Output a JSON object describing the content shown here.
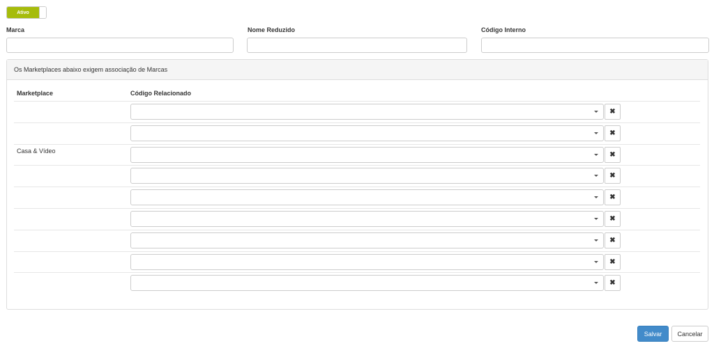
{
  "status_toggle": {
    "label": "Ativo",
    "color": "#a6bc0b"
  },
  "fields": [
    {
      "label": "Marca",
      "value": "",
      "placeholder": ""
    },
    {
      "label": "Nome Reduzido",
      "value": "",
      "placeholder": ""
    },
    {
      "label": "Código Interno",
      "value": "",
      "placeholder": ""
    }
  ],
  "marketplaces_panel": {
    "heading": "Os Marketplaces abaixo exigem associação de Marcas",
    "columns": {
      "marketplace": "Marketplace",
      "related_code": "Código Relacionado"
    },
    "marketplace_name": "Casa & Vídeo",
    "select_value": "",
    "row_count": 9,
    "remove_icon": "times-icon",
    "remove_glyph": "✖"
  },
  "actions": {
    "save": "Salvar",
    "cancel": "Cancelar",
    "save_color": "#428bca"
  }
}
